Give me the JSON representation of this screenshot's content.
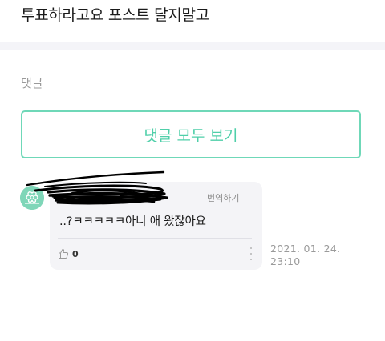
{
  "post": {
    "title": "투표하라고요 포스트 달지말고"
  },
  "comments_section": {
    "heading": "댓글",
    "view_all_label": "댓글 모두 보기"
  },
  "comment": {
    "author": "",
    "translate_label": "번역하기",
    "text": "..?ㅋㅋㅋㅋㅋ아니 애 왔잖아요",
    "like_count": "0",
    "timestamp_line1": "2021. 01. 24.",
    "timestamp_line2": "23:10",
    "icons": {
      "like": "thumbs-up-icon",
      "more": "more-vertical-icon",
      "avatar": "flower-avatar-icon"
    }
  },
  "colors": {
    "accent": "#4fcfa9",
    "button_border": "#6fd8b8",
    "card_bg": "#f4f4f7",
    "avatar_bg": "#7fd6b8",
    "redaction_scribble": "#000000"
  }
}
